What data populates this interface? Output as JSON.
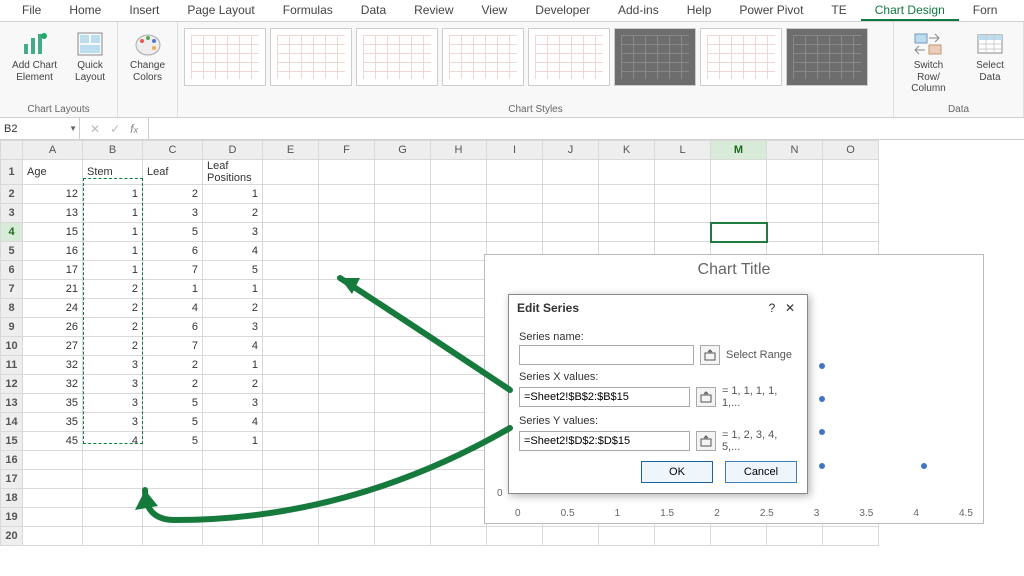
{
  "tabs": [
    "File",
    "Home",
    "Insert",
    "Page Layout",
    "Formulas",
    "Data",
    "Review",
    "View",
    "Developer",
    "Add-ins",
    "Help",
    "Power Pivot",
    "TE",
    "Chart Design",
    "Forn"
  ],
  "active_tab": "Chart Design",
  "ribbon": {
    "chart_layouts": {
      "add_chart_element": "Add Chart Element",
      "quick_layout": "Quick Layout",
      "group_label": "Chart Layouts"
    },
    "change_colors": "Change Colors",
    "chart_styles_label": "Chart Styles",
    "data_group": {
      "switch": "Switch Row/\nColumn",
      "select": "Select Data",
      "group_label": "Data"
    }
  },
  "namebox": "B2",
  "columns": [
    "A",
    "B",
    "C",
    "D",
    "E",
    "F",
    "G",
    "H",
    "I",
    "J",
    "K",
    "L",
    "M",
    "N",
    "O"
  ],
  "headers": {
    "A": "Age",
    "B": "Stem",
    "C": "Leaf",
    "D": "Leaf Positions"
  },
  "rows": [
    {
      "A": 12,
      "B": 1,
      "C": 2,
      "D": 1
    },
    {
      "A": 13,
      "B": 1,
      "C": 3,
      "D": 2
    },
    {
      "A": 15,
      "B": 1,
      "C": 5,
      "D": 3
    },
    {
      "A": 16,
      "B": 1,
      "C": 6,
      "D": 4
    },
    {
      "A": 17,
      "B": 1,
      "C": 7,
      "D": 5
    },
    {
      "A": 21,
      "B": 2,
      "C": 1,
      "D": 1
    },
    {
      "A": 24,
      "B": 2,
      "C": 4,
      "D": 2
    },
    {
      "A": 26,
      "B": 2,
      "C": 6,
      "D": 3
    },
    {
      "A": 27,
      "B": 2,
      "C": 7,
      "D": 4
    },
    {
      "A": 32,
      "B": 3,
      "C": 2,
      "D": 1
    },
    {
      "A": 32,
      "B": 3,
      "C": 2,
      "D": 2
    },
    {
      "A": 35,
      "B": 3,
      "C": 5,
      "D": 3
    },
    {
      "A": 35,
      "B": 3,
      "C": 5,
      "D": 4
    },
    {
      "A": 45,
      "B": 4,
      "C": 5,
      "D": 1
    }
  ],
  "row_count_visible": 20,
  "chart": {
    "title": "Chart Title",
    "x_ticks": [
      "0",
      "0.5",
      "1",
      "1.5",
      "2",
      "2.5",
      "3",
      "3.5",
      "4",
      "4.5"
    ],
    "y_zero": "0"
  },
  "chart_data": {
    "type": "scatter",
    "title": "Chart Title",
    "xlabel": "",
    "ylabel": "",
    "xlim": [
      0,
      4.5
    ],
    "ylim": [
      0,
      6
    ],
    "series": [
      {
        "name": "",
        "x": [
          1,
          1,
          1,
          1,
          1,
          2,
          2,
          2,
          2,
          3,
          3,
          3,
          3,
          4
        ],
        "y": [
          1,
          2,
          3,
          4,
          5,
          1,
          2,
          3,
          4,
          1,
          2,
          3,
          4,
          1
        ]
      }
    ]
  },
  "dialog": {
    "title": "Edit Series",
    "name_label": "Series name:",
    "name_value": "",
    "name_hint": "Select Range",
    "x_label": "Series X values:",
    "x_value": "=Sheet2!$B$2:$B$15",
    "x_preview": "= 1, 1, 1, 1, 1,...",
    "y_label": "Series Y values:",
    "y_value": "=Sheet2!$D$2:$D$15",
    "y_preview": "= 1, 2, 3, 4, 5,...",
    "ok": "OK",
    "cancel": "Cancel"
  }
}
